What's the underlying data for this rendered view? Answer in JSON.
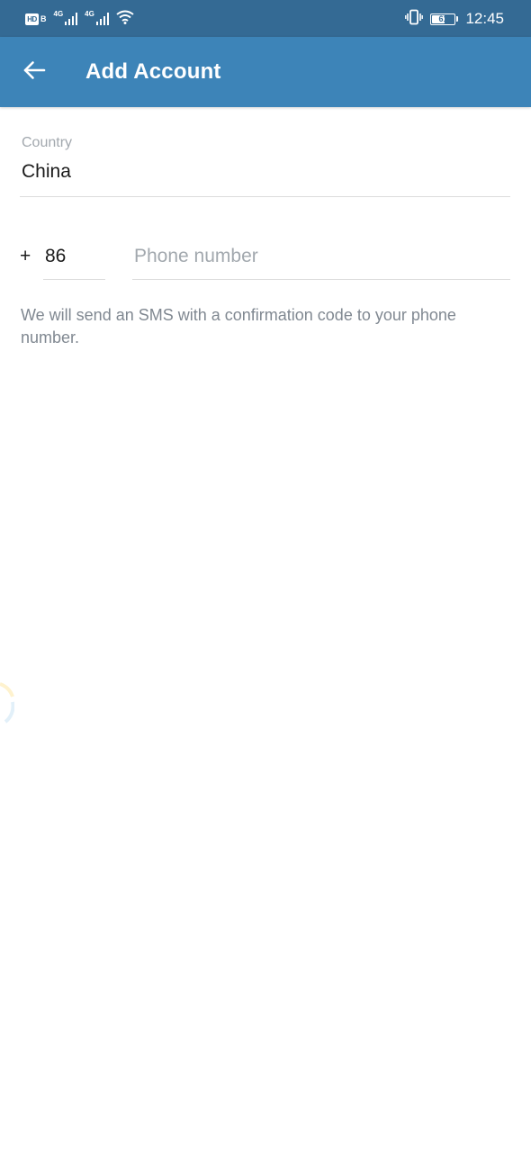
{
  "status_bar": {
    "hd_label": "HD",
    "hd_suffix": "B",
    "sim1_network": "4G",
    "sim2_network": "4G",
    "battery_level": "61",
    "battery_fraction": 0.61,
    "time": "12:45",
    "icons": [
      "hd-voice-icon",
      "signal-icon",
      "signal-icon",
      "wifi-icon",
      "vibrate-icon",
      "battery-icon"
    ]
  },
  "app_bar": {
    "title": "Add Account",
    "back_icon": "arrow-left-icon",
    "background": "#3d84b8"
  },
  "form": {
    "country_label": "Country",
    "country_value": "China",
    "plus": "+",
    "country_code": "86",
    "phone_placeholder": "Phone number",
    "phone_value": "",
    "info": "We will send an SMS with a confirmation code to your phone number."
  },
  "colors": {
    "status_bar": "#346a94",
    "app_bar": "#3d84b8",
    "divider": "#dcdcdc",
    "hint": "#a2a8ae",
    "info_text": "#808891"
  }
}
